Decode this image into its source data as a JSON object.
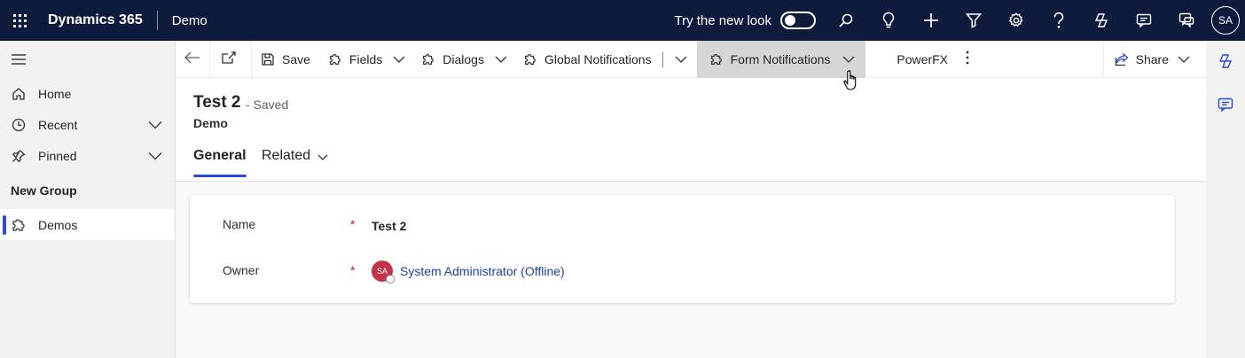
{
  "topbar": {
    "app_title": "Dynamics 365",
    "env_name": "Demo",
    "try_new_look": "Try the new look",
    "user_initials": "SA",
    "icons": [
      "waffle-icon",
      "search-icon",
      "lightbulb-icon",
      "plus-icon",
      "filter-icon",
      "settings-icon",
      "help-icon",
      "copilot-icon",
      "chat-icon",
      "feedback-icon"
    ]
  },
  "sidebar": {
    "items": [
      {
        "label": "Home",
        "icon": "home-icon"
      },
      {
        "label": "Recent",
        "icon": "clock-icon"
      },
      {
        "label": "Pinned",
        "icon": "pin-icon"
      }
    ],
    "group_label": "New Group",
    "group_items": [
      {
        "label": "Demos",
        "icon": "puzzle-icon",
        "selected": true
      }
    ]
  },
  "commandbar": {
    "save": "Save",
    "fields": "Fields",
    "dialogs": "Dialogs",
    "global_notifications": "Global Notifications",
    "form_notifications": "Form Notifications",
    "powerfx": "PowerFX",
    "share": "Share"
  },
  "record": {
    "title": "Test 2",
    "status": "- Saved",
    "entity": "Demo"
  },
  "tabs": {
    "general": "General",
    "related": "Related"
  },
  "form": {
    "name_label": "Name",
    "name_value": "Test 2",
    "owner_label": "Owner",
    "owner_initials": "SA",
    "owner_value": "System Administrator (Offline)",
    "required_marker": "*"
  },
  "colors": {
    "topbar": "#0e1b3d",
    "accent": "#2b4cd8",
    "link": "#1f3fa8",
    "required": "#a4262c",
    "owner_avatar": "#c4314b"
  }
}
